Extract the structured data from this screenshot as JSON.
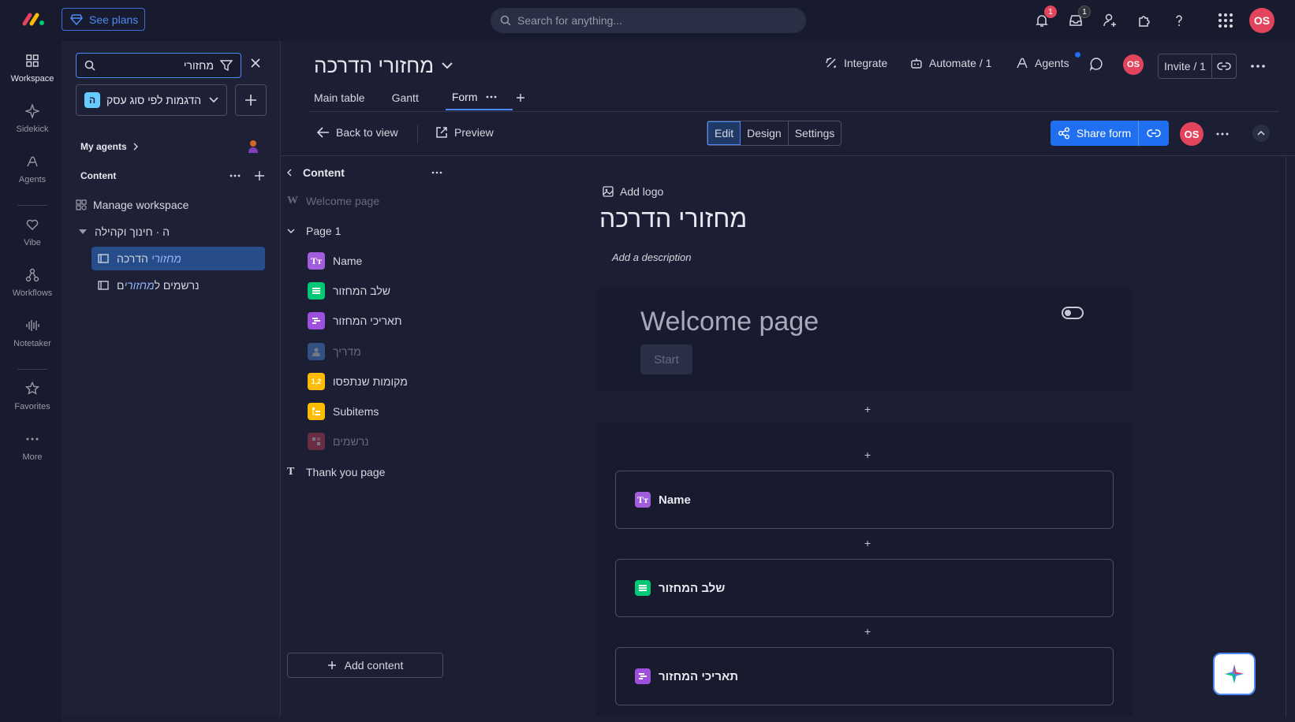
{
  "topbar": {
    "see_plans": "See plans",
    "search_placeholder": "Search for anything...",
    "notifications_count": "1",
    "inbox_count": "1",
    "avatar": "OS"
  },
  "rail": [
    {
      "label": "Workspace",
      "icon": "grid-icon"
    },
    {
      "label": "Sidekick",
      "icon": "sparkle-icon"
    },
    {
      "label": "Agents",
      "icon": "agent-icon"
    },
    {
      "label": "Vibe",
      "icon": "heart-icon"
    },
    {
      "label": "Workflows",
      "icon": "workflow-icon"
    },
    {
      "label": "Notetaker",
      "icon": "waveform-icon"
    },
    {
      "label": "Favorites",
      "icon": "star-icon"
    },
    {
      "label": "More",
      "icon": "more-icon"
    }
  ],
  "sidebar": {
    "search_value": "מחזורי",
    "workspace_name": "הדגמות לפי סוג עסק",
    "workspace_badge": "ה",
    "my_agents": "My agents",
    "content": "Content",
    "manage_workspace": "Manage workspace",
    "folder": "ה · חינוך וקהילה",
    "boards": [
      {
        "hl": "מחזורי",
        "rest": " הדרכה"
      },
      {
        "pre": "נרשמים ל",
        "hl": "מחזורי",
        "post": "ם"
      }
    ]
  },
  "header": {
    "board_title": "מחזורי הדרכה",
    "integrate": "Integrate",
    "automate": "Automate / 1",
    "agents": "Agents",
    "avatar": "OS",
    "invite": "Invite / 1",
    "tabs": [
      "Main table",
      "Gantt",
      "Form"
    ]
  },
  "toolbar": {
    "back": "Back to view",
    "preview": "Preview",
    "segments": [
      "Edit",
      "Design",
      "Settings"
    ],
    "share": "Share form",
    "avatar": "OS"
  },
  "content_panel": {
    "title": "Content",
    "welcome": "Welcome page",
    "page1": "Page 1",
    "fields": [
      {
        "label": "Name",
        "icon": "TT",
        "color": "#a25ddc",
        "dim": false
      },
      {
        "label": "שלב המחזור",
        "icon": "status",
        "color": "#00c875",
        "dim": false
      },
      {
        "label": "תאריכי המחזור",
        "icon": "timeline",
        "color": "#9d50dd",
        "dim": false
      },
      {
        "label": "מדריך",
        "icon": "person",
        "color": "#579bfc",
        "dim": true
      },
      {
        "label": "מקומות שנתפסו",
        "icon": "numbers",
        "color": "#fdbc00",
        "dim": false
      },
      {
        "label": "Subitems",
        "icon": "subitems",
        "color": "#fdbc00",
        "dim": false
      },
      {
        "label": "נרשמים",
        "icon": "connect",
        "color": "#e2445c",
        "dim": true
      }
    ],
    "thank_you": "Thank you page",
    "add_content": "Add content"
  },
  "form": {
    "add_logo": "Add logo",
    "title": "מחזורי הדרכה",
    "description": "Add a description",
    "welcome_title": "Welcome page",
    "start": "Start",
    "questions": [
      {
        "label": "Name",
        "color": "#a25ddc"
      },
      {
        "label": "שלב המחזור",
        "color": "#00c875"
      },
      {
        "label": "תאריכי המחזור",
        "color": "#9d50dd"
      }
    ]
  },
  "colors": {
    "accent": "#1f6ff0",
    "danger": "#e2445c",
    "background": "#1c1f33"
  }
}
